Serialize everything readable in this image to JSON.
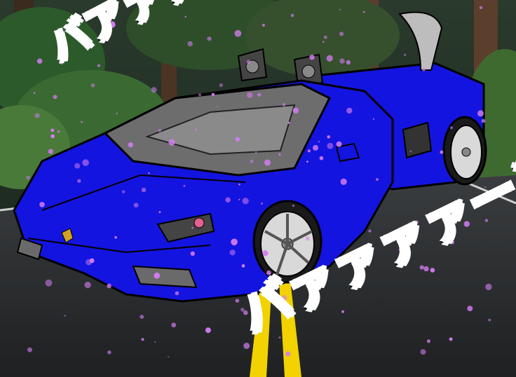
{
  "effects": {
    "top_text": "バアァァァーン",
    "bottom_text": "バァァァァーン"
  },
  "colors": {
    "car_body": "#1414e0",
    "sparkle": "#d27cf0",
    "road": "#2c2f31",
    "lane_line": "#f2d200",
    "forest": "#1f3a22"
  }
}
